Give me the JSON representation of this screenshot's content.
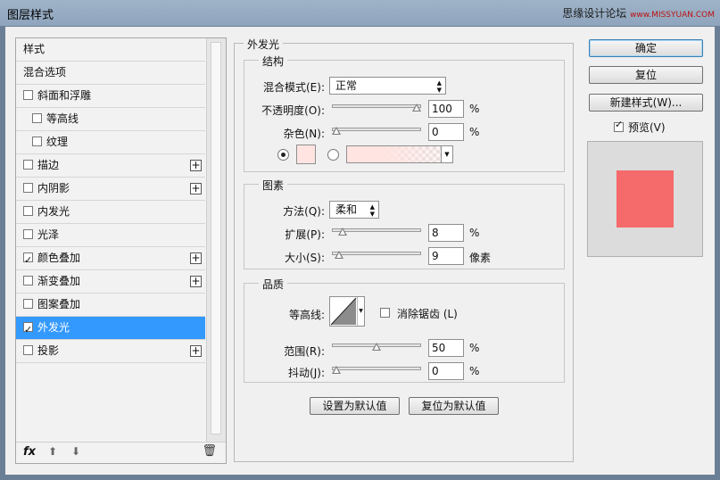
{
  "window": {
    "title": "图层样式",
    "watermark": "思缘设计论坛",
    "watermark_sub": "www.MISSYUAN.COM"
  },
  "style_list": {
    "items": [
      {
        "label": "样式",
        "checkbox": false,
        "checked": false,
        "plus": false,
        "sub": false,
        "selected": false
      },
      {
        "label": "混合选项",
        "checkbox": false,
        "checked": false,
        "plus": false,
        "sub": false,
        "selected": false
      },
      {
        "label": "斜面和浮雕",
        "checkbox": true,
        "checked": false,
        "plus": false,
        "sub": false,
        "selected": false
      },
      {
        "label": "等高线",
        "checkbox": true,
        "checked": false,
        "plus": false,
        "sub": true,
        "selected": false
      },
      {
        "label": "纹理",
        "checkbox": true,
        "checked": false,
        "plus": false,
        "sub": true,
        "selected": false
      },
      {
        "label": "描边",
        "checkbox": true,
        "checked": false,
        "plus": true,
        "sub": false,
        "selected": false
      },
      {
        "label": "内阴影",
        "checkbox": true,
        "checked": false,
        "plus": true,
        "sub": false,
        "selected": false
      },
      {
        "label": "内发光",
        "checkbox": true,
        "checked": false,
        "plus": false,
        "sub": false,
        "selected": false
      },
      {
        "label": "光泽",
        "checkbox": true,
        "checked": false,
        "plus": false,
        "sub": false,
        "selected": false
      },
      {
        "label": "颜色叠加",
        "checkbox": true,
        "checked": true,
        "plus": true,
        "sub": false,
        "selected": false
      },
      {
        "label": "渐变叠加",
        "checkbox": true,
        "checked": false,
        "plus": true,
        "sub": false,
        "selected": false
      },
      {
        "label": "图案叠加",
        "checkbox": true,
        "checked": false,
        "plus": false,
        "sub": false,
        "selected": false
      },
      {
        "label": "外发光",
        "checkbox": true,
        "checked": true,
        "plus": false,
        "sub": false,
        "selected": true
      },
      {
        "label": "投影",
        "checkbox": true,
        "checked": false,
        "plus": true,
        "sub": false,
        "selected": false
      }
    ],
    "footer": {
      "fx_label": "fx",
      "up_icon": "arrow-up-icon",
      "down_icon": "arrow-down-icon",
      "trash_icon": "trash-icon"
    }
  },
  "panel": {
    "title": "外发光",
    "structure": {
      "title": "结构",
      "blend_mode_label": "混合模式(E):",
      "blend_mode_value": "正常",
      "opacity_label": "不透明度(O):",
      "opacity_value": "100",
      "opacity_unit": "%",
      "noise_label": "杂色(N):",
      "noise_value": "0",
      "noise_unit": "%",
      "color_swatch": "#ffe4e1",
      "solid_color_selected": true
    },
    "elements": {
      "title": "图素",
      "method_label": "方法(Q):",
      "method_value": "柔和",
      "spread_label": "扩展(P):",
      "spread_value": "8",
      "spread_unit": "%",
      "size_label": "大小(S):",
      "size_value": "9",
      "size_unit": "像素"
    },
    "quality": {
      "title": "品质",
      "contour_label": "等高线:",
      "antialias_label": "消除锯齿 (L)",
      "antialias_checked": false,
      "range_label": "范围(R):",
      "range_value": "50",
      "range_unit": "%",
      "jitter_label": "抖动(J):",
      "jitter_value": "0",
      "jitter_unit": "%"
    },
    "set_default_label": "设置为默认值",
    "reset_default_label": "复位为默认值"
  },
  "sidebar": {
    "ok_label": "确定",
    "reset_label": "复位",
    "new_style_label": "新建样式(W)...",
    "preview_label": "预览(V)",
    "preview_checked": true,
    "preview_color": "#f56a6a"
  }
}
